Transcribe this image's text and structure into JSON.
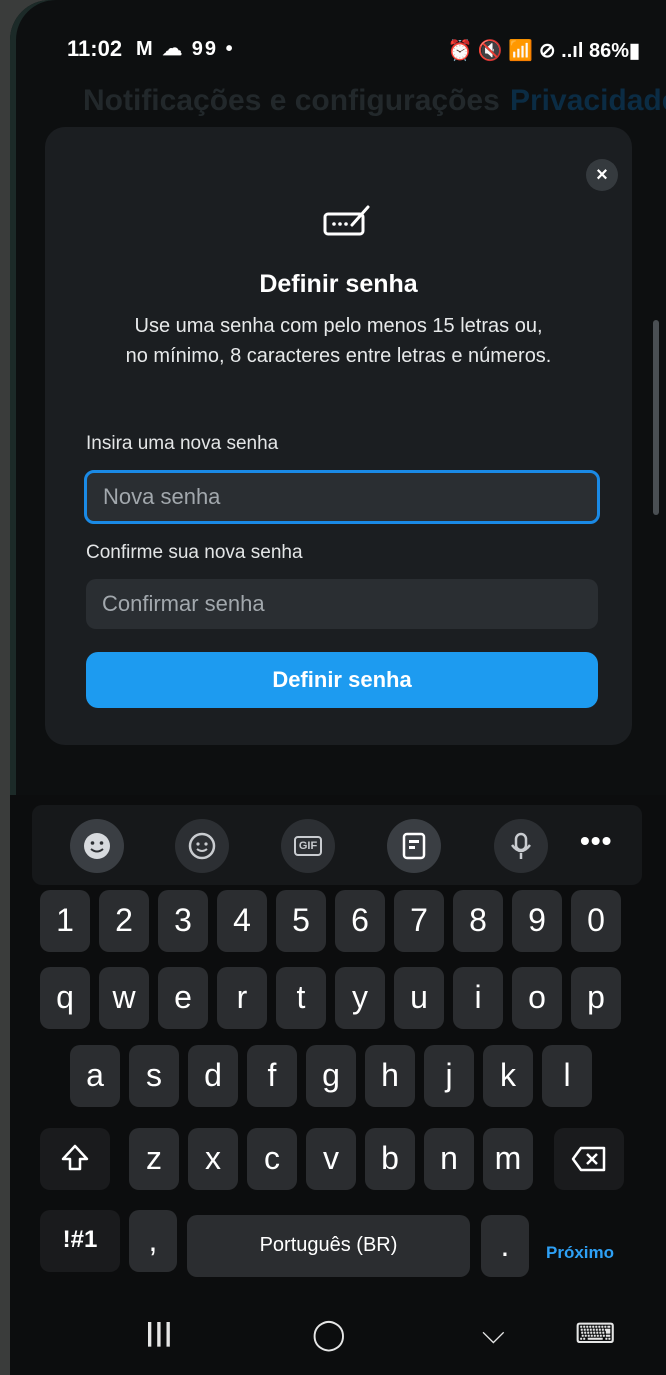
{
  "status": {
    "time": "11:02",
    "left_icons": "M ☁ 99 •",
    "right_icons": "⏰ 🔇 📶 ⊘ ..ıl",
    "battery": "86%"
  },
  "background": {
    "title": "Notificações e configurações",
    "partial_tab": "Privacidade"
  },
  "dialog": {
    "title": "Definir senha",
    "description": "Use uma senha com pelo menos 15 letras ou, no mínimo, 8 caracteres entre letras e números.",
    "new_label": "Insira uma nova senha",
    "new_placeholder": "Nova senha",
    "confirm_label": "Confirme sua nova senha",
    "confirm_placeholder": "Confirmar senha",
    "submit": "Definir senha",
    "close": "×"
  },
  "keyboard": {
    "toolbar": {
      "gif": "GIF",
      "more": "•••"
    },
    "row_numbers": [
      "1",
      "2",
      "3",
      "4",
      "5",
      "6",
      "7",
      "8",
      "9",
      "0"
    ],
    "row1": [
      "q",
      "w",
      "e",
      "r",
      "t",
      "y",
      "u",
      "i",
      "o",
      "p"
    ],
    "row2": [
      "a",
      "s",
      "d",
      "f",
      "g",
      "h",
      "j",
      "k",
      "l"
    ],
    "row3": [
      "z",
      "x",
      "c",
      "v",
      "b",
      "n",
      "m"
    ],
    "symbols": "!#1",
    "comma": ",",
    "space": "Português (BR)",
    "period": ".",
    "next": "Próximo"
  },
  "navbar": {
    "recents": "|||",
    "home": "◯",
    "back": "⌵",
    "keyboard": "⌨"
  }
}
